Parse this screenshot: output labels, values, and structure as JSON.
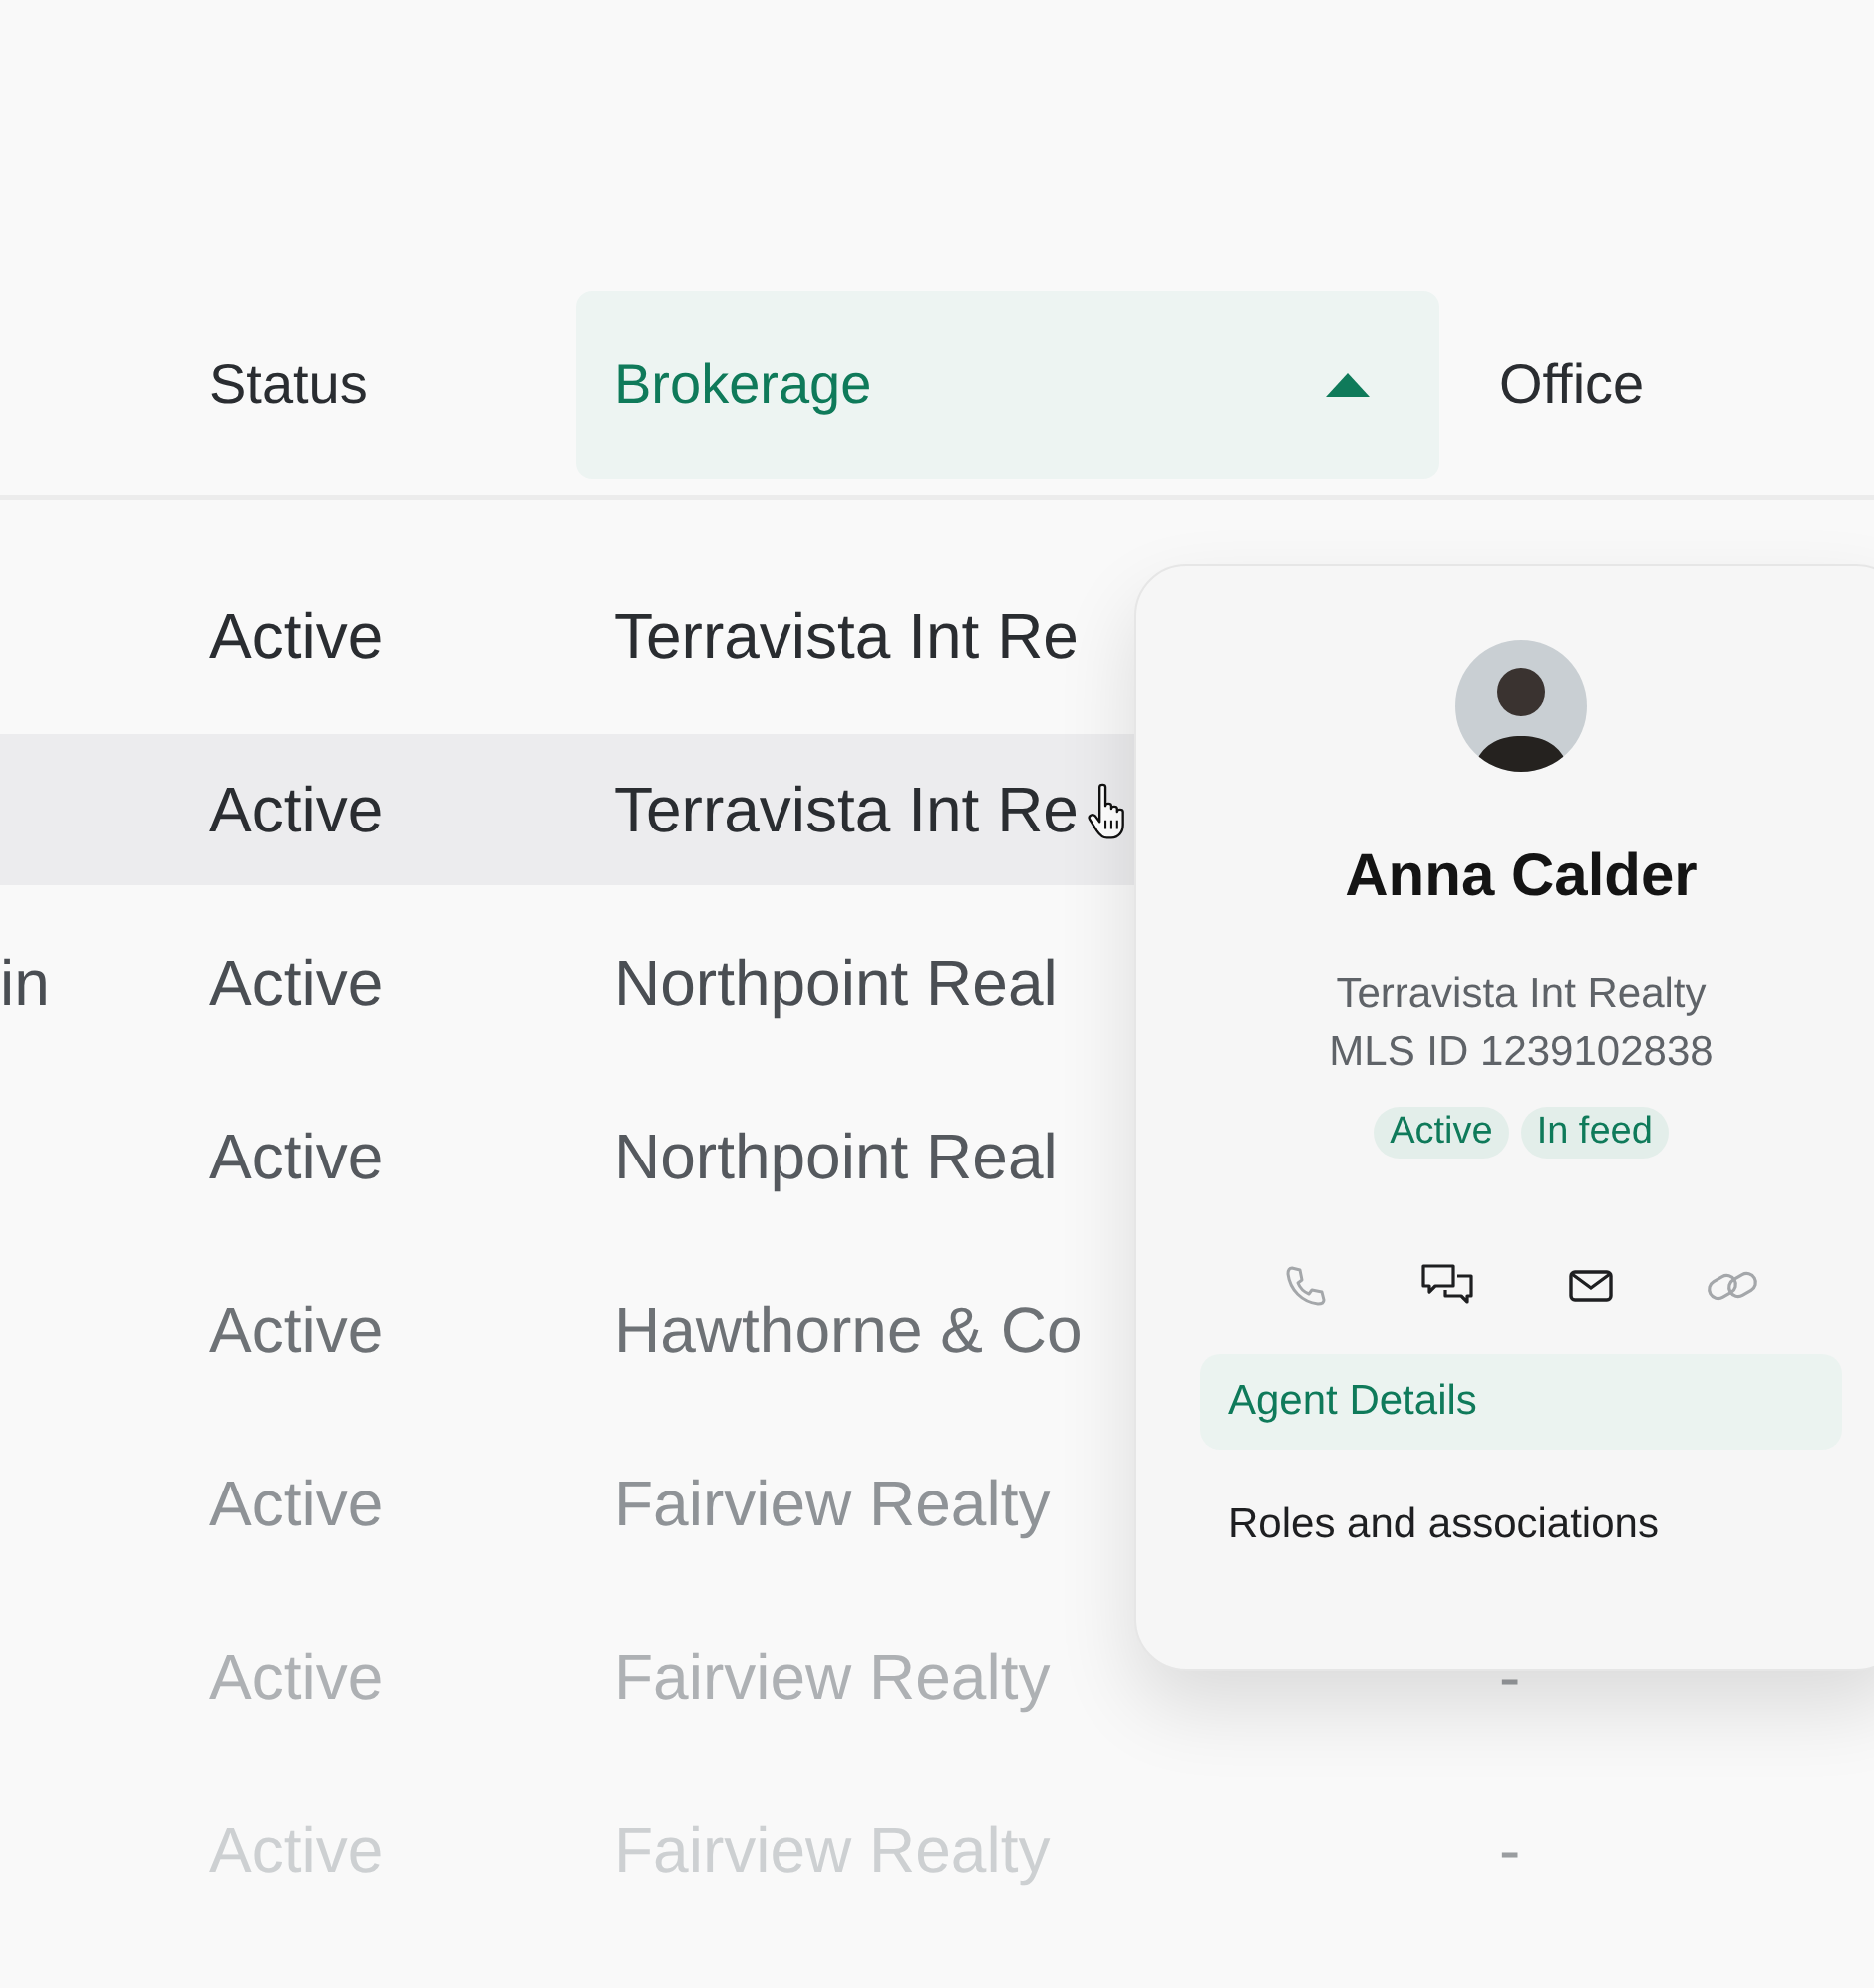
{
  "table": {
    "columns": [
      {
        "label": "Status",
        "selected": false
      },
      {
        "label": "Brokerage",
        "selected": true,
        "sort_ascending": true
      },
      {
        "label": "Office",
        "selected": false
      }
    ],
    "rows": [
      {
        "status": "Active",
        "brokerage": "Terravista Int Re",
        "hovered": false
      },
      {
        "status": "Active",
        "brokerage": "Terravista Int Re",
        "hovered": true
      },
      {
        "column_1": "in",
        "status": "Active",
        "brokerage": "Northpoint Real",
        "hovered": false
      },
      {
        "status": "Active",
        "brokerage": "Northpoint Real",
        "hovered": false
      },
      {
        "status": "Active",
        "brokerage": "Hawthorne & Co",
        "hovered": false
      },
      {
        "status": "Active",
        "brokerage": "Fairview Realty",
        "hovered": false
      },
      {
        "status": "Active",
        "brokerage": "Fairview Realty",
        "office": "-",
        "hovered": false
      },
      {
        "status": "Active",
        "brokerage": "Fairview Realty",
        "office": "-",
        "hovered": false
      }
    ]
  },
  "agent_card": {
    "name": "Anna Calder",
    "brokerage": "Terravista Int Realty",
    "mls_id": "MLS ID 1239102838",
    "tags": [
      "Active",
      "In feed"
    ],
    "actions": [
      {
        "kind": "phone",
        "disabled": true
      },
      {
        "kind": "chat",
        "disabled": false
      },
      {
        "kind": "mail",
        "disabled": false
      },
      {
        "kind": "link",
        "disabled": true
      }
    ],
    "menu": [
      {
        "label": "Agent Details",
        "selected": true
      },
      {
        "label": "Roles and associations",
        "selected": false
      }
    ]
  }
}
